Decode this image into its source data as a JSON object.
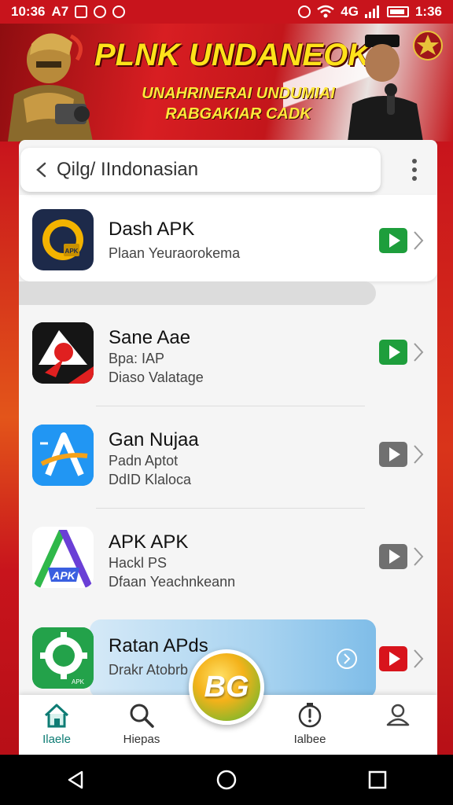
{
  "status_bar": {
    "time_left": "10:36",
    "carrier": "A7",
    "signal_text": "4G",
    "time_right": "1:36"
  },
  "banner": {
    "title": "PLNK UNDANEOK",
    "subtitle1": "UNAHRINERAI UNDUMIAI",
    "subtitle2": "RABGAKIAR CADK"
  },
  "search": {
    "text": "Qilg/ IIndonasian"
  },
  "apps": [
    {
      "name": "Dash APK",
      "line1": "Plaan Yeuraorokema",
      "line2": "",
      "button_color": "#1e9e3c"
    },
    {
      "name": "Sane Aae",
      "line1": "Bpa: IAP",
      "line2": "Diaso Valatage",
      "button_color": "#1e9e3c"
    },
    {
      "name": "Gan Nujaa",
      "line1": "Padn Aptot",
      "line2": "DdID Klaloca",
      "button_color": "#707070"
    },
    {
      "name": "APK APK",
      "line1": "Hackl PS",
      "line2": "Dfaan Yeachnkeann",
      "button_color": "#707070"
    },
    {
      "name": "Ratan APds",
      "line1": "Drakr Atobrb",
      "line2": "",
      "button_color": "#d8141c"
    }
  ],
  "app_icon_text": {
    "dash": "APK",
    "apk": "APK",
    "ratan": "APK"
  },
  "fab_label": "BG",
  "bottom_nav": [
    {
      "label": "Ilaele",
      "icon": "home-icon"
    },
    {
      "label": "Hiepas",
      "icon": "search-icon"
    },
    {
      "label": "Ialbee",
      "icon": "clock-icon"
    },
    {
      "label": "",
      "icon": "profile-icon"
    }
  ]
}
